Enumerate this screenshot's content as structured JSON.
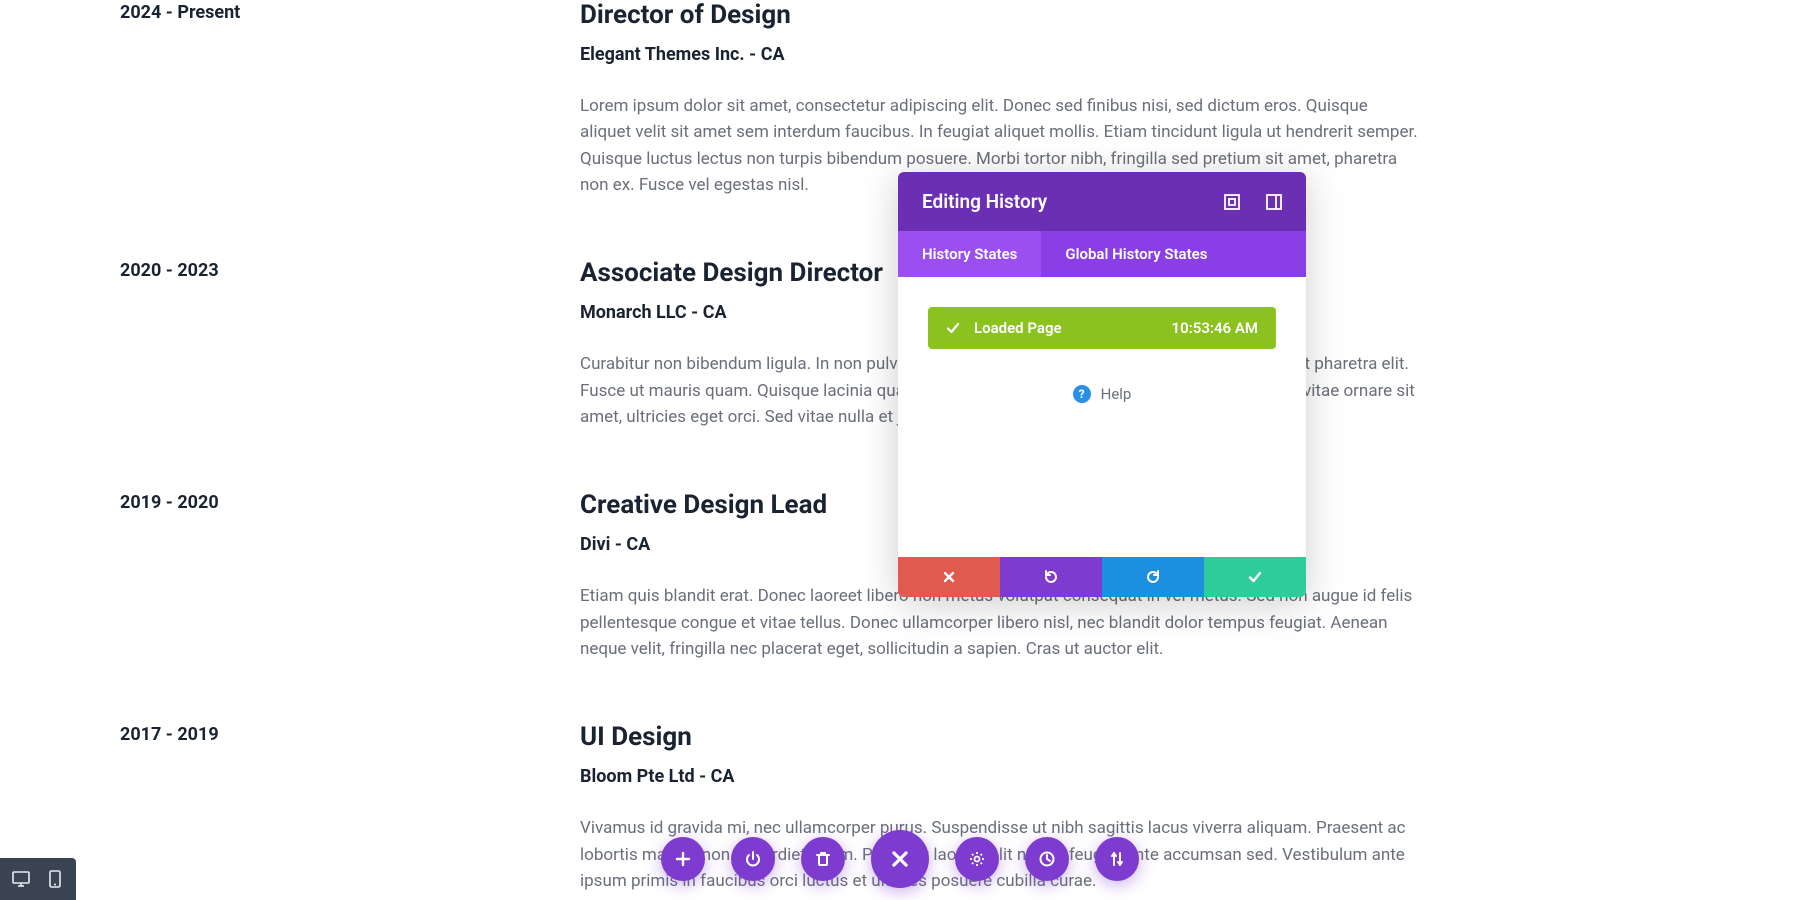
{
  "jobs": [
    {
      "date": "2024 - Present",
      "title": "Director of Design",
      "company": "Elegant Themes Inc. - CA",
      "desc": "Lorem ipsum dolor sit amet, consectetur adipiscing elit. Donec sed finibus nisi, sed dictum eros. Quisque aliquet velit sit amet sem interdum faucibus. In feugiat aliquet mollis. Etiam tincidunt ligula ut hendrerit semper. Quisque luctus lectus non turpis bibendum posuere. Morbi tortor nibh, fringilla sed pretium sit amet, pharetra non ex. Fusce vel egestas nisl."
    },
    {
      "date": "2020 - 2023",
      "title": "Associate Design Director",
      "company": "Monarch LLC - CA",
      "desc": "Curabitur non bibendum ligula. In non pulvinar purus. Curabitur nisi odio, blandit et elit at, suscipit pharetra elit. Fusce ut mauris quam. Quisque lacinia quam eu commodo mollis. Praesent nisl massa, ultrices vitae ornare sit amet, ultricies eget orci. Sed vitae nulla et justo pellentesque congue nec eu risus."
    },
    {
      "date": "2019 - 2020",
      "title": "Creative Design Lead",
      "company": "Divi - CA",
      "desc": "Etiam quis blandit erat. Donec laoreet libero non metus volutpat consequat in vel metus. Sed non augue id felis pellentesque congue et vitae tellus. Donec ullamcorper libero nisl, nec blandit dolor tempus feugiat. Aenean neque velit, fringilla nec placerat eget, sollicitudin a sapien. Cras ut auctor elit."
    },
    {
      "date": "2017 - 2019",
      "title": "UI Design",
      "company": "Bloom Pte Ltd - CA",
      "desc": "Vivamus id gravida mi, nec ullamcorper purus. Suspendisse ut nibh sagittis lacus viverra aliquam. Praesent ac lobortis mauris, non imperdiet quam. Praesent laoreet elit nisi, id feugiat ante accumsan sed. Vestibulum ante ipsum primis in faucibus orci luctus et ultrices posuere cubilia curae."
    }
  ],
  "panel": {
    "title": "Editing History",
    "tabs": {
      "history": "History States",
      "global": "Global History States"
    },
    "item": {
      "label": "Loaded Page",
      "time": "10:53:46 AM"
    },
    "help": "Help"
  },
  "colors": {
    "purple_dark": "#6b2fb3",
    "purple_mid": "#8a3ee6",
    "purple_light": "#9b4ff0",
    "purple_btn": "#7e3bd0",
    "green": "#8bc220",
    "red": "#e15a4f",
    "blue": "#1d8fe0",
    "teal": "#2ecc9a"
  }
}
